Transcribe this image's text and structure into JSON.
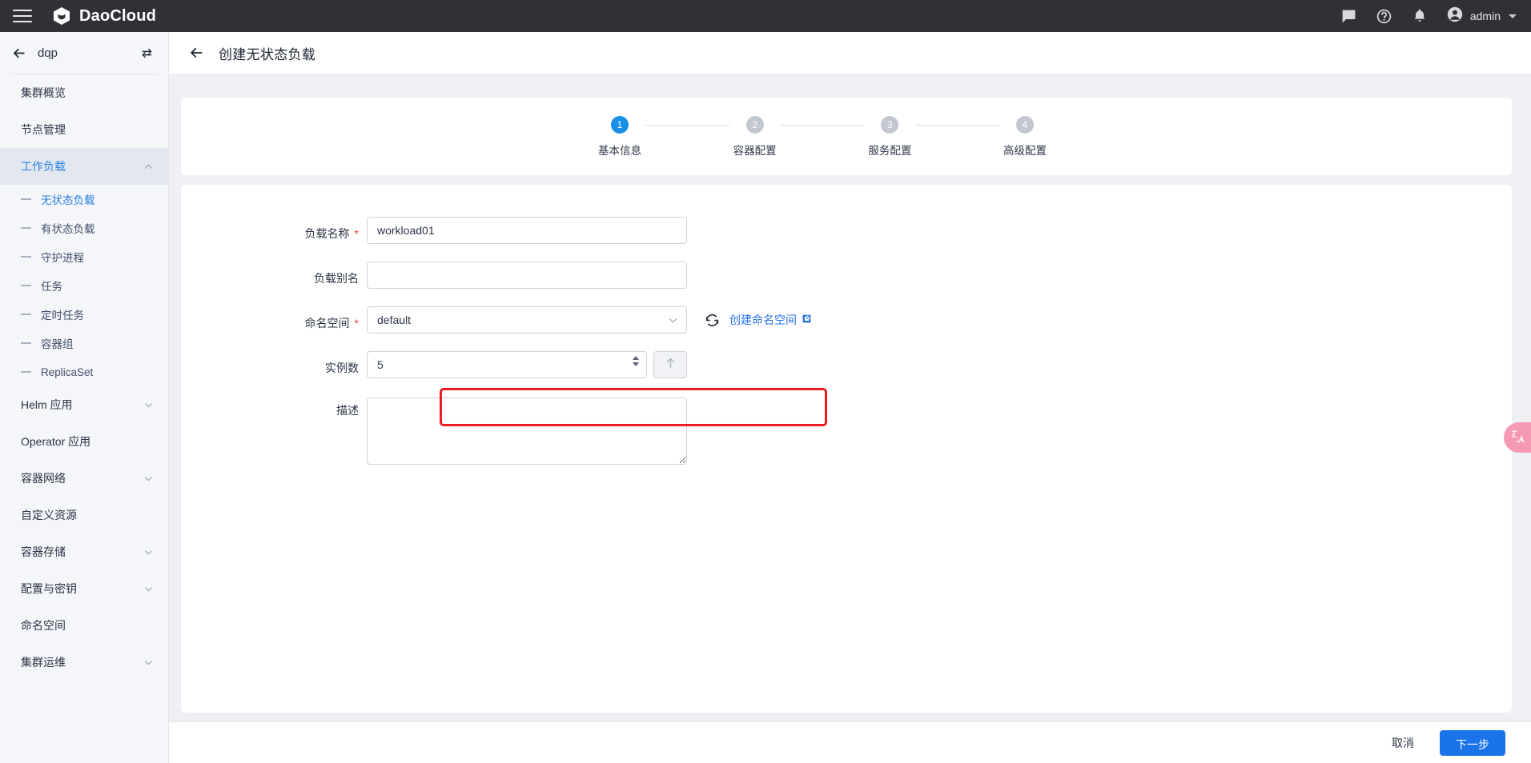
{
  "topbar": {
    "menu_icon": "hamburger-icon",
    "brand": "DaoCloud",
    "icons": [
      "message-icon",
      "help-icon",
      "bell-icon"
    ],
    "user": "admin"
  },
  "sidebar": {
    "cluster_name": "dqp",
    "back_icon": "arrow-left-icon",
    "switch_icon": "switch-cluster-icon",
    "items": [
      {
        "label": "集群概览",
        "type": "item"
      },
      {
        "label": "节点管理",
        "type": "item"
      },
      {
        "label": "工作负载",
        "type": "group",
        "expanded": true,
        "active": true
      },
      {
        "label": "无状态负载",
        "type": "sub",
        "current": true
      },
      {
        "label": "有状态负载",
        "type": "sub"
      },
      {
        "label": "守护进程",
        "type": "sub"
      },
      {
        "label": "任务",
        "type": "sub"
      },
      {
        "label": "定时任务",
        "type": "sub"
      },
      {
        "label": "容器组",
        "type": "sub"
      },
      {
        "label": "ReplicaSet",
        "type": "sub"
      },
      {
        "label": "Helm 应用",
        "type": "group",
        "expanded": false
      },
      {
        "label": "Operator 应用",
        "type": "item"
      },
      {
        "label": "容器网络",
        "type": "group",
        "expanded": false
      },
      {
        "label": "自定义资源",
        "type": "item"
      },
      {
        "label": "容器存储",
        "type": "group",
        "expanded": false
      },
      {
        "label": "配置与密钥",
        "type": "group",
        "expanded": false
      },
      {
        "label": "命名空间",
        "type": "item"
      },
      {
        "label": "集群运维",
        "type": "group",
        "expanded": false
      }
    ]
  },
  "page": {
    "back_icon": "arrow-left-icon",
    "title": "创建无状态负载"
  },
  "steps": [
    {
      "num": "1",
      "label": "基本信息",
      "active": true
    },
    {
      "num": "2",
      "label": "容器配置",
      "active": false
    },
    {
      "num": "3",
      "label": "服务配置",
      "active": false
    },
    {
      "num": "4",
      "label": "高级配置",
      "active": false
    }
  ],
  "form": {
    "name": {
      "label": "负载名称",
      "required": true,
      "value": "workload01",
      "placeholder": ""
    },
    "alias": {
      "label": "负载别名",
      "required": false,
      "value": "",
      "placeholder": ""
    },
    "namespace": {
      "label": "命名空间",
      "required": true,
      "value": "default",
      "refresh_icon": "refresh-icon",
      "link_label": "创建命名空间",
      "link_icon": "external-link-icon"
    },
    "replicas": {
      "label": "实例数",
      "required": false,
      "value": "5",
      "spinner_icon": "number-spinner-icon",
      "scale_icon": "arrow-up-icon",
      "highlighted": true,
      "highlight_color": "#ed1c24"
    },
    "description": {
      "label": "描述",
      "required": false,
      "value": "",
      "placeholder": ""
    }
  },
  "footer": {
    "cancel_label": "取消",
    "next_label": "下一步"
  },
  "widgets": {
    "translate_label": "中A",
    "translate_color": "#f59ab5"
  },
  "colors": {
    "accent": "#1a73e8",
    "link": "#2a72e8",
    "topbar_bg": "#2f3137",
    "sidebar_bg": "#f4f6f9",
    "page_bg": "#eef0f4",
    "required_mark": "#e8403a"
  }
}
